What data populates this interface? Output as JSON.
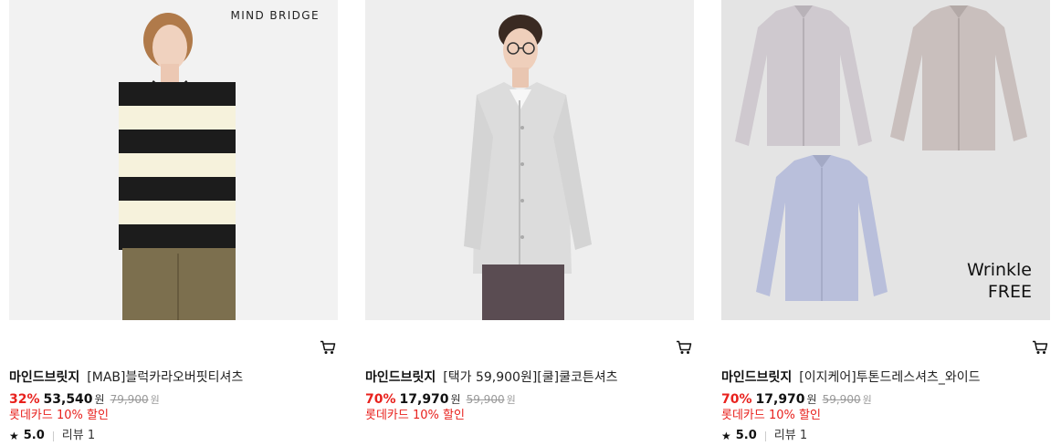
{
  "products": [
    {
      "brand": "마인드브릿지",
      "title": "[MAB]블럭카라오버핏티셔츠",
      "discount": "32%",
      "sale_price": "53,540",
      "currency": "원",
      "original_price": "79,900",
      "promo": "롯데카드 10% 할인",
      "rating": "5.0",
      "review_label": "리뷰 1",
      "image_overlay_text": "MIND BRIDGE",
      "cart_icon": "cart-icon",
      "star_icon": "star-icon"
    },
    {
      "brand": "마인드브릿지",
      "title": "[택가 59,900원][쿨]쿨코튼셔츠",
      "discount": "70%",
      "sale_price": "17,970",
      "currency": "원",
      "original_price": "59,900",
      "promo": "롯데카드 10% 할인",
      "cart_icon": "cart-icon"
    },
    {
      "brand": "마인드브릿지",
      "title": "[이지케어]투톤드레스셔츠_와이드",
      "discount": "70%",
      "sale_price": "17,970",
      "currency": "원",
      "original_price": "59,900",
      "promo": "롯데카드 10% 할인",
      "rating": "5.0",
      "review_label": "리뷰 1",
      "image_overlay_text_line1": "Wrinkle",
      "image_overlay_text_line2": "FREE",
      "cart_icon": "cart-icon",
      "star_icon": "star-icon"
    }
  ],
  "colors": {
    "discount": "#e8211d",
    "promo": "#e8211d",
    "original_price": "#999999"
  }
}
